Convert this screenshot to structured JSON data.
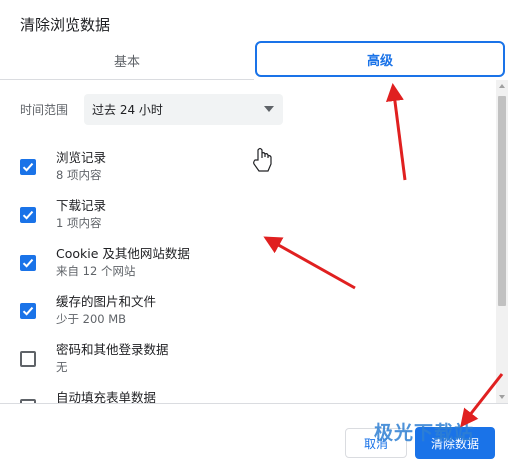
{
  "dialog": {
    "title": "清除浏览数据"
  },
  "tabs": {
    "basic": "基本",
    "advanced": "高级"
  },
  "time_range": {
    "label": "时间范围",
    "value": "过去 24 小时"
  },
  "items": [
    {
      "title": "浏览记录",
      "subtitle": "8 项内容",
      "checked": true
    },
    {
      "title": "下载记录",
      "subtitle": "1 项内容",
      "checked": true
    },
    {
      "title": "Cookie 及其他网站数据",
      "subtitle": "来自 12 个网站",
      "checked": true
    },
    {
      "title": "缓存的图片和文件",
      "subtitle": "少于 200 MB",
      "checked": true
    },
    {
      "title": "密码和其他登录数据",
      "subtitle": "无",
      "checked": false
    },
    {
      "title": "自动填充表单数据",
      "subtitle": "",
      "checked": false
    }
  ],
  "buttons": {
    "cancel": "取消",
    "clear": "清除数据"
  },
  "watermark": "极光下载站",
  "colors": {
    "accent": "#1a73e8",
    "annotation": "#e02020"
  }
}
